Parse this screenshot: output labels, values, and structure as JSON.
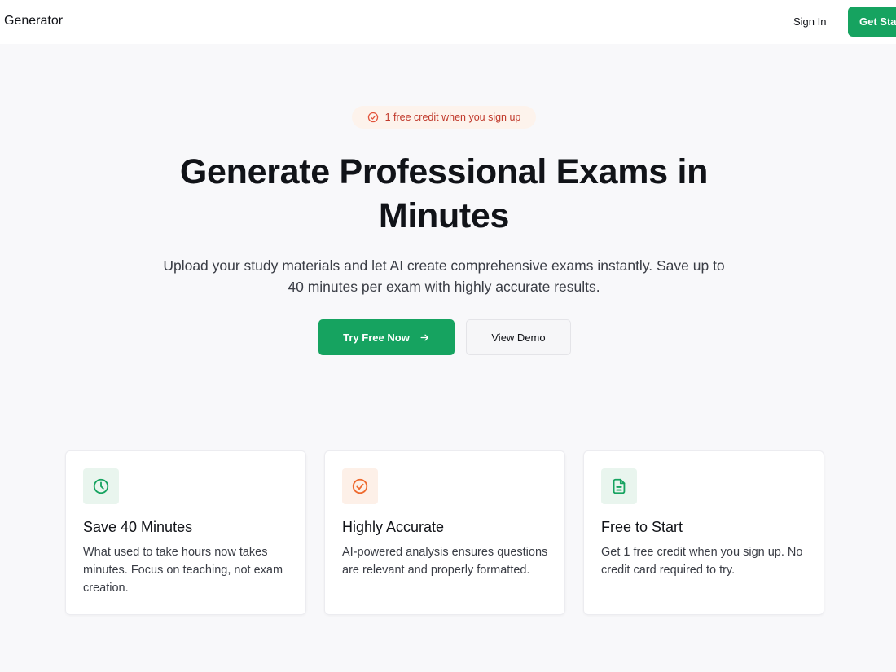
{
  "header": {
    "brand": "Generator",
    "sign_in": "Sign In",
    "get_started": "Get Started"
  },
  "hero": {
    "badge": "1 free credit when you sign up",
    "title": "Generate Professional Exams in Minutes",
    "subtitle": "Upload your study materials and let AI create comprehensive exams instantly. Save up to 40 minutes per exam with highly accurate results.",
    "primary_cta": "Try Free Now",
    "secondary_cta": "View Demo"
  },
  "features": [
    {
      "icon": "clock-icon",
      "title": "Save 40 Minutes",
      "description": "What used to take hours now takes minutes. Focus on teaching, not exam creation."
    },
    {
      "icon": "check-circle-icon",
      "title": "Highly Accurate",
      "description": "AI-powered analysis ensures questions are relevant and properly formatted."
    },
    {
      "icon": "document-icon",
      "title": "Free to Start",
      "description": "Get 1 free credit when you sign up. No credit card required to try."
    }
  ],
  "colors": {
    "accent_green": "#16a360",
    "badge_bg": "#fdf3ec",
    "badge_text": "#c0392b",
    "page_bg": "#f8f8fa"
  }
}
